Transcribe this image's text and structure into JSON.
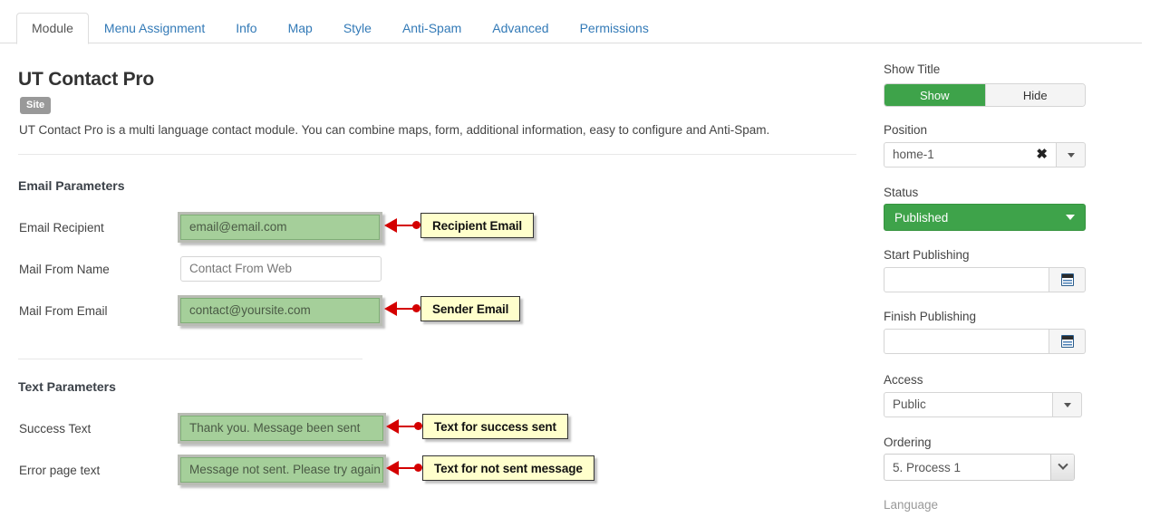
{
  "tabs": [
    {
      "label": "Module",
      "active": true
    },
    {
      "label": "Menu Assignment",
      "active": false
    },
    {
      "label": "Info",
      "active": false
    },
    {
      "label": "Map",
      "active": false
    },
    {
      "label": "Style",
      "active": false
    },
    {
      "label": "Anti-Spam",
      "active": false
    },
    {
      "label": "Advanced",
      "active": false
    },
    {
      "label": "Permissions",
      "active": false
    }
  ],
  "main": {
    "title": "UT Contact Pro",
    "badge": "Site",
    "description": "UT Contact Pro is a multi language contact module. You can combine maps, form, additional information, easy to configure and Anti-Spam.",
    "section_email": "Email Parameters",
    "section_text": "Text Parameters",
    "fields": {
      "email_recipient_label": "Email Recipient",
      "email_recipient_value": "email@email.com",
      "mail_from_name_label": "Mail From Name",
      "mail_from_name_value": "Contact From Web",
      "mail_from_email_label": "Mail From Email",
      "mail_from_email_value": "contact@yoursite.com",
      "success_text_label": "Success Text",
      "success_text_value": "Thank you. Message been sent",
      "error_text_label": "Error page text",
      "error_text_value": "Message not sent. Please try again"
    },
    "callouts": {
      "recipient": "Recipient Email",
      "sender": "Sender Email",
      "success": "Text for success sent",
      "error": "Text for not sent message"
    }
  },
  "sidebar": {
    "show_title_label": "Show Title",
    "show_title_on": "Show",
    "show_title_off": "Hide",
    "position_label": "Position",
    "position_value": "home-1",
    "position_clear": "✖",
    "status_label": "Status",
    "status_value": "Published",
    "start_publishing_label": "Start Publishing",
    "start_publishing_value": "",
    "finish_publishing_label": "Finish Publishing",
    "finish_publishing_value": "",
    "access_label": "Access",
    "access_value": "Public",
    "ordering_label": "Ordering",
    "ordering_value": "5. Process 1",
    "language_label": "Language"
  },
  "colors": {
    "accent_green": "#3ea34a",
    "highlight_green": "#a5cf9a",
    "callout_yellow": "#ffffcc",
    "arrow_red": "#d40000",
    "tab_link": "#337ab7",
    "badge_gray": "#999999"
  }
}
